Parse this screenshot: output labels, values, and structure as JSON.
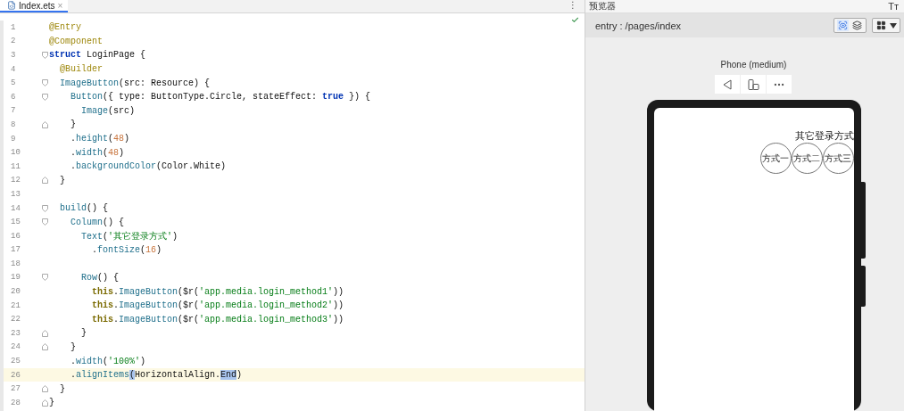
{
  "editor": {
    "tab": {
      "label": "Index.ets",
      "close": "×",
      "selected": true
    },
    "menu": "⋮",
    "lines": [
      {
        "n": "1",
        "kind": "plain",
        "tokens": [
          {
            "kind": "deco",
            "t": "@Entry"
          }
        ]
      },
      {
        "n": "2",
        "kind": "plain",
        "tokens": [
          {
            "kind": "deco",
            "t": "@Component"
          }
        ]
      },
      {
        "n": "3",
        "kind": "opener",
        "tokens": [
          {
            "kind": "kw",
            "t": "struct"
          },
          {
            "kind": "p",
            "t": " LoginPage {"
          }
        ]
      },
      {
        "n": "4",
        "kind": "plain",
        "tokens": [
          {
            "kind": "deco",
            "t": "  @Builder"
          }
        ]
      },
      {
        "n": "5",
        "kind": "opener",
        "tokens": [
          {
            "kind": "fn",
            "t": "  ImageButton"
          },
          {
            "kind": "p",
            "t": "(src: Resource) {"
          }
        ]
      },
      {
        "n": "6",
        "kind": "opener",
        "tokens": [
          {
            "kind": "fn",
            "t": "    Button"
          },
          {
            "kind": "p",
            "t": "({ type: ButtonType.Circle, stateEffect: "
          },
          {
            "kind": "kw",
            "t": "true"
          },
          {
            "kind": "p",
            "t": " }) {"
          }
        ]
      },
      {
        "n": "7",
        "kind": "plain",
        "tokens": [
          {
            "kind": "fn",
            "t": "      Image"
          },
          {
            "kind": "p",
            "t": "(src)"
          }
        ]
      },
      {
        "n": "8",
        "kind": "closer",
        "tokens": [
          {
            "kind": "p",
            "t": "    }"
          }
        ]
      },
      {
        "n": "9",
        "kind": "plain",
        "tokens": [
          {
            "kind": "p",
            "t": "    ."
          },
          {
            "kind": "fn",
            "t": "height"
          },
          {
            "kind": "p",
            "t": "("
          },
          {
            "kind": "num",
            "t": "48"
          },
          {
            "kind": "p",
            "t": ")"
          }
        ]
      },
      {
        "n": "10",
        "kind": "plain",
        "tokens": [
          {
            "kind": "p",
            "t": "    ."
          },
          {
            "kind": "fn",
            "t": "width"
          },
          {
            "kind": "p",
            "t": "("
          },
          {
            "kind": "num",
            "t": "48"
          },
          {
            "kind": "p",
            "t": ")"
          }
        ]
      },
      {
        "n": "11",
        "kind": "plain",
        "tokens": [
          {
            "kind": "p",
            "t": "    ."
          },
          {
            "kind": "fn",
            "t": "backgroundColor"
          },
          {
            "kind": "p",
            "t": "(Color.White)"
          }
        ]
      },
      {
        "n": "12",
        "kind": "closer",
        "tokens": [
          {
            "kind": "p",
            "t": "  }"
          }
        ]
      },
      {
        "n": "13",
        "kind": "plain"
      },
      {
        "n": "14",
        "kind": "opener",
        "tokens": [
          {
            "kind": "fn",
            "t": "  build"
          },
          {
            "kind": "p",
            "t": "() {"
          }
        ]
      },
      {
        "n": "15",
        "kind": "opener",
        "tokens": [
          {
            "kind": "fn",
            "t": "    Column"
          },
          {
            "kind": "p",
            "t": "() {"
          }
        ]
      },
      {
        "n": "16",
        "kind": "plain",
        "tokens": [
          {
            "kind": "fn",
            "t": "      Text"
          },
          {
            "kind": "p",
            "t": "("
          },
          {
            "kind": "str",
            "t": "'其它登录方式'"
          },
          {
            "kind": "p",
            "t": ")"
          }
        ]
      },
      {
        "n": "17",
        "kind": "plain",
        "tokens": [
          {
            "kind": "p",
            "t": "        ."
          },
          {
            "kind": "fn",
            "t": "fontSize"
          },
          {
            "kind": "p",
            "t": "("
          },
          {
            "kind": "num",
            "t": "16"
          },
          {
            "kind": "p",
            "t": ")"
          }
        ]
      },
      {
        "n": "18",
        "kind": "plain"
      },
      {
        "n": "19",
        "kind": "opener",
        "tokens": [
          {
            "kind": "fn",
            "t": "      Row"
          },
          {
            "kind": "p",
            "t": "() {"
          }
        ]
      },
      {
        "n": "20",
        "kind": "plain",
        "tokens": [
          {
            "kind": "this",
            "t": "        this"
          },
          {
            "kind": "p",
            "t": "."
          },
          {
            "kind": "fn",
            "t": "ImageButton"
          },
          {
            "kind": "p",
            "t": "($r("
          },
          {
            "kind": "str",
            "t": "'app.media.login_method1'"
          },
          {
            "kind": "p",
            "t": "))"
          }
        ]
      },
      {
        "n": "21",
        "kind": "plain",
        "tokens": [
          {
            "kind": "this",
            "t": "        this"
          },
          {
            "kind": "p",
            "t": "."
          },
          {
            "kind": "fn",
            "t": "ImageButton"
          },
          {
            "kind": "p",
            "t": "($r("
          },
          {
            "kind": "str",
            "t": "'app.media.login_method2'"
          },
          {
            "kind": "p",
            "t": "))"
          }
        ]
      },
      {
        "n": "22",
        "kind": "plain",
        "tokens": [
          {
            "kind": "this",
            "t": "        this"
          },
          {
            "kind": "p",
            "t": "."
          },
          {
            "kind": "fn",
            "t": "ImageButton"
          },
          {
            "kind": "p",
            "t": "($r("
          },
          {
            "kind": "str",
            "t": "'app.media.login_method3'"
          },
          {
            "kind": "p",
            "t": "))"
          }
        ]
      },
      {
        "n": "23",
        "kind": "closer",
        "tokens": [
          {
            "kind": "p",
            "t": "      }"
          }
        ]
      },
      {
        "n": "24",
        "kind": "closer",
        "tokens": [
          {
            "kind": "p",
            "t": "    }"
          }
        ]
      },
      {
        "n": "25",
        "kind": "plain",
        "tokens": [
          {
            "kind": "p",
            "t": "    ."
          },
          {
            "kind": "fn",
            "t": "width"
          },
          {
            "kind": "p",
            "t": "("
          },
          {
            "kind": "str",
            "t": "'100%'"
          },
          {
            "kind": "p",
            "t": ")"
          }
        ]
      },
      {
        "n": "26",
        "kind": "plain",
        "current": true,
        "tokens": [
          {
            "kind": "p",
            "t": "    ."
          },
          {
            "kind": "fn",
            "t": "alignItems"
          },
          {
            "kind": "match",
            "t": "("
          },
          {
            "kind": "p",
            "t": "HorizontalAlign."
          },
          {
            "kind": "match",
            "t": "End"
          },
          {
            "kind": "p",
            "t": ")"
          }
        ]
      },
      {
        "n": "27",
        "kind": "closer",
        "tokens": [
          {
            "kind": "p",
            "t": "  }"
          }
        ]
      },
      {
        "n": "28",
        "kind": "closer",
        "tokens": [
          {
            "kind": "p",
            "t": "}"
          }
        ]
      }
    ]
  },
  "preview": {
    "title": "预览器",
    "font_icon": "Tт",
    "route": "entry : /pages/index",
    "device": "Phone (medium)",
    "screen": {
      "heading": "其它登录方式",
      "buttons": [
        "方式一",
        "方式二",
        "方式三"
      ]
    }
  }
}
